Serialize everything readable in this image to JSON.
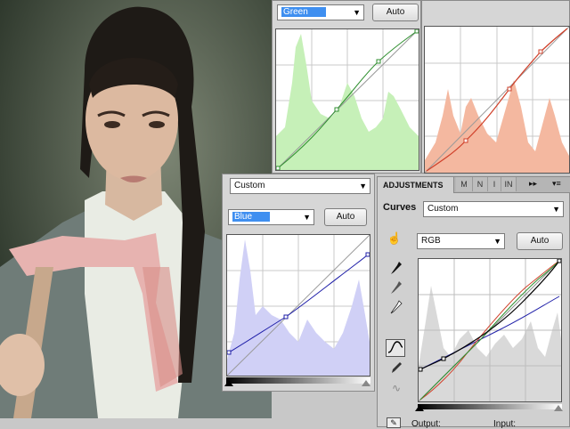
{
  "green_panel": {
    "channel": "Green",
    "auto_label": "Auto"
  },
  "blue_panel": {
    "preset": "Custom",
    "channel": "Blue",
    "auto_label": "Auto"
  },
  "adjustments_panel": {
    "tab_title": "ADJUSTMENTS",
    "other_tabs": [
      "M",
      "N",
      "I",
      "IN"
    ],
    "section_label": "Curves",
    "preset": "Custom",
    "channel": "RGB",
    "auto_label": "Auto",
    "output_label": "Output:",
    "input_label": "Input:"
  },
  "icons": {
    "on_image_adjust": "hand-adjust-icon",
    "black_point": "eyedropper-black-icon",
    "gray_point": "eyedropper-gray-icon",
    "white_point": "eyedropper-white-icon",
    "curve_tool": "curve-tool-icon",
    "pencil_tool": "pencil-icon",
    "smooth_tool": "smooth-icon"
  },
  "colors": {
    "green_curve": "#2f8f2f",
    "green_histogram": "#c6f0b8",
    "red_curve": "#d0402a",
    "red_histogram": "#f4b8a0",
    "blue_curve": "#1f1fa8",
    "blue_histogram": "#d0d0f6",
    "selection": "#3f8ff0"
  }
}
